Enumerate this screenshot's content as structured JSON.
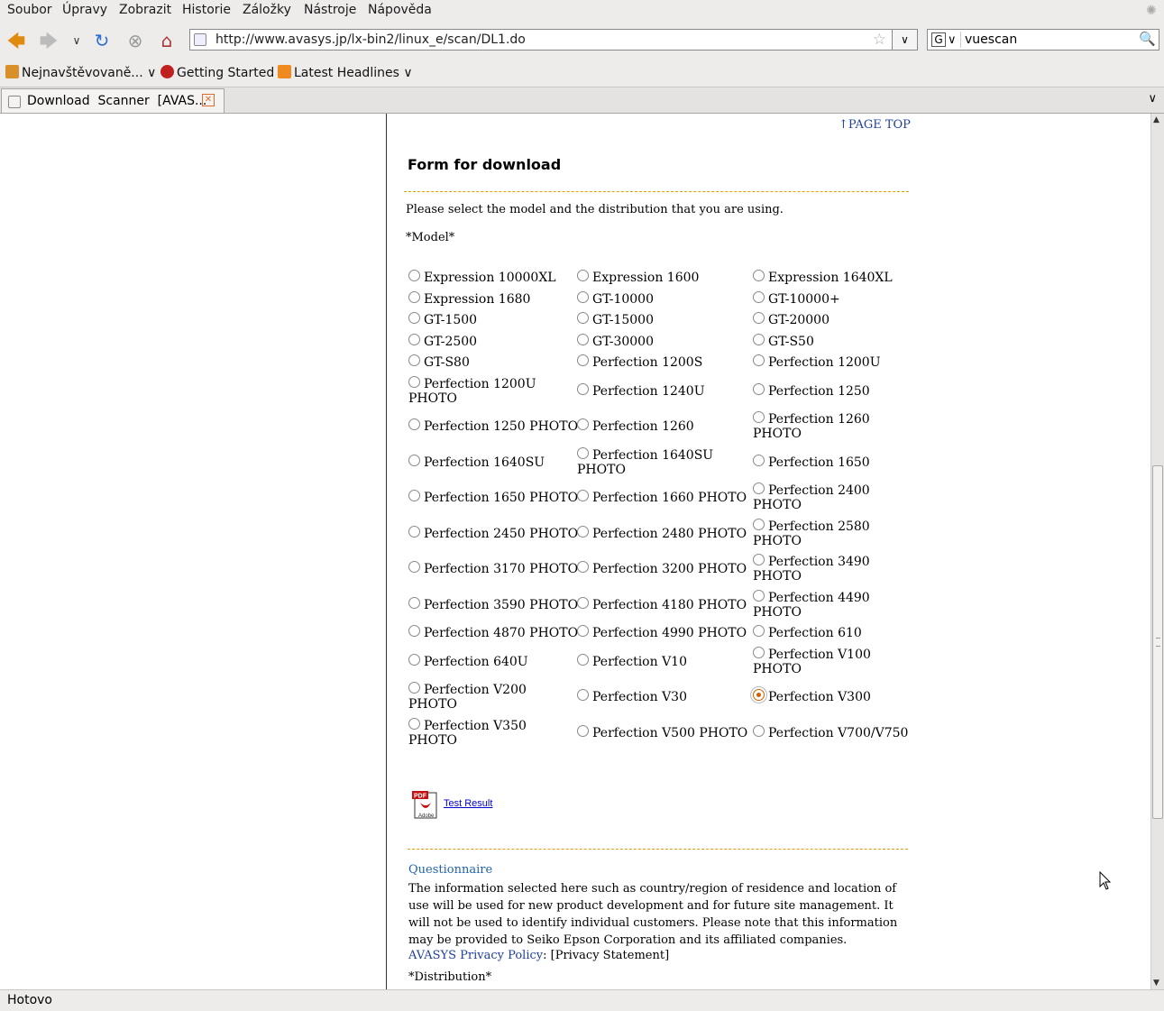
{
  "menu": [
    "Soubor",
    "Úpravy",
    "Zobrazit",
    "Historie",
    "Záložky",
    "Nástroje",
    "Nápověda"
  ],
  "nav": {
    "back_icon": "back-arrow-icon",
    "forward_icon": "forward-arrow-icon",
    "reload_icon": "reload-icon",
    "stop_icon": "stop-icon",
    "home_icon": "home-icon",
    "url": "http://www.avasys.jp/lx-bin2/linux_e/scan/DL1.do",
    "search_value": "vuescan",
    "search_engine": "G"
  },
  "bookmarks": [
    "Nejnavštěvovaně...",
    "Getting Started",
    "Latest Headlines"
  ],
  "tab": {
    "label": "Download  Scanner  [AVAS..."
  },
  "page": {
    "page_top": "↑PAGE TOP",
    "form_title": "Form for download",
    "instruction": "Please select the model and the distribution that you are using.",
    "model_label": "*Model*",
    "models": [
      [
        "Expression 10000XL",
        "Expression 1600",
        "Expression 1640XL"
      ],
      [
        "Expression 1680",
        "GT-10000",
        "GT-10000+"
      ],
      [
        "GT-1500",
        "GT-15000",
        "GT-20000"
      ],
      [
        "GT-2500",
        "GT-30000",
        "GT-S50"
      ],
      [
        "GT-S80",
        "Perfection 1200S",
        "Perfection 1200U"
      ],
      [
        "Perfection 1200U PHOTO",
        "Perfection 1240U",
        "Perfection 1250"
      ],
      [
        "Perfection 1250 PHOTO",
        "Perfection 1260",
        "Perfection 1260 PHOTO"
      ],
      [
        "Perfection 1640SU",
        "Perfection 1640SU PHOTO",
        "Perfection 1650"
      ],
      [
        "Perfection 1650 PHOTO",
        "Perfection 1660 PHOTO",
        "Perfection 2400 PHOTO"
      ],
      [
        "Perfection 2450 PHOTO",
        "Perfection 2480 PHOTO",
        "Perfection 2580 PHOTO"
      ],
      [
        "Perfection 3170 PHOTO",
        "Perfection 3200 PHOTO",
        "Perfection 3490 PHOTO"
      ],
      [
        "Perfection 3590 PHOTO",
        "Perfection 4180 PHOTO",
        "Perfection 4490 PHOTO"
      ],
      [
        "Perfection 4870 PHOTO",
        "Perfection 4990 PHOTO",
        "Perfection 610"
      ],
      [
        "Perfection 640U",
        "Perfection V10",
        "Perfection V100 PHOTO"
      ],
      [
        "Perfection V200 PHOTO",
        "Perfection V30",
        "Perfection V300"
      ],
      [
        "Perfection V350 PHOTO",
        "Perfection V500 PHOTO",
        "Perfection V700/V750"
      ]
    ],
    "selected_model": "Perfection V300",
    "test_result": "Test Result",
    "pdf_icon": "pdf-adobe-icon",
    "questionnaire": "Questionnaire",
    "questionnaire_text": "The information selected here such as country/region of residence and location of use will be used for new product development and for future site management. It will not be used to identify individual customers. Please note that this information may be provided to Seiko Epson Corporation and its affiliated companies.",
    "privacy_link": "AVASYS Privacy Policy",
    "privacy_statement": ": [Privacy Statement]",
    "distribution_label": "*Distribution*"
  },
  "status": "Hotovo",
  "colors": {
    "accent_rule": "#e0a000",
    "link": "#1f3f9f",
    "selected_radio": "#d06000"
  }
}
